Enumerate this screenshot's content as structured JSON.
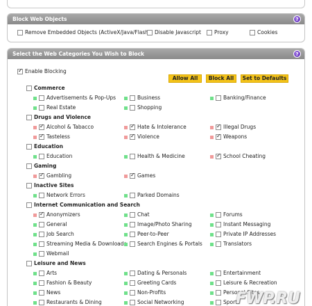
{
  "block_web_objects": {
    "title": "Block Web Objects",
    "help": "?",
    "options": [
      {
        "label": "Remove Embedded Objects (ActiveX/Java/Flash)",
        "checked": false
      },
      {
        "label": "Disable Javascript",
        "checked": false
      },
      {
        "label": "Proxy",
        "checked": false
      },
      {
        "label": "Cookies",
        "checked": false
      }
    ]
  },
  "categories_panel": {
    "title": "Select the Web Categories You Wish to Block",
    "help": "?",
    "enable_blocking": {
      "label": "Enable Blocking",
      "checked": true
    },
    "buttons": {
      "allow_all": "Allow All",
      "block_all": "Block All",
      "defaults": "Set to Defaults"
    },
    "groups": [
      {
        "title": "Commerce",
        "items": [
          {
            "label": "Advertisements & Pop-Ups",
            "checked": false,
            "mark": "green"
          },
          {
            "label": "Business",
            "checked": false,
            "mark": "green"
          },
          {
            "label": "Banking/Finance",
            "checked": false,
            "mark": "green"
          },
          {
            "label": "Real Estate",
            "checked": false,
            "mark": "green"
          },
          {
            "label": "Shopping",
            "checked": false,
            "mark": "green"
          }
        ]
      },
      {
        "title": "Drugs and Violence",
        "items": [
          {
            "label": "Alcohol & Tabacco",
            "checked": true,
            "mark": "red"
          },
          {
            "label": "Hate & Intolerance",
            "checked": true,
            "mark": "red"
          },
          {
            "label": "Illegal Drugs",
            "checked": true,
            "mark": "red"
          },
          {
            "label": "Tasteless",
            "checked": true,
            "mark": "red"
          },
          {
            "label": "Violence",
            "checked": true,
            "mark": "red"
          },
          {
            "label": "Weapons",
            "checked": true,
            "mark": "red"
          }
        ]
      },
      {
        "title": "Education",
        "items": [
          {
            "label": "Education",
            "checked": false,
            "mark": "green"
          },
          {
            "label": "Health & Medicine",
            "checked": false,
            "mark": "green"
          },
          {
            "label": "School Cheating",
            "checked": true,
            "mark": "red"
          }
        ]
      },
      {
        "title": "Gaming",
        "items": [
          {
            "label": "Gambling",
            "checked": true,
            "mark": "red"
          },
          {
            "label": "Games",
            "checked": true,
            "mark": "red"
          }
        ]
      },
      {
        "title": "Inactive Sites",
        "items": [
          {
            "label": "Network Errors",
            "checked": false,
            "mark": "green"
          },
          {
            "label": "Parked Domains",
            "checked": false,
            "mark": "green"
          }
        ]
      },
      {
        "title": "Internet Communication and Search",
        "items": [
          {
            "label": "Anonymizers",
            "checked": true,
            "mark": "red"
          },
          {
            "label": "Chat",
            "checked": false,
            "mark": "green"
          },
          {
            "label": "Forums",
            "checked": false,
            "mark": "green"
          },
          {
            "label": "General",
            "checked": false,
            "mark": "green"
          },
          {
            "label": "Image/Photo Sharing",
            "checked": false,
            "mark": "green"
          },
          {
            "label": "Instant Messaging",
            "checked": false,
            "mark": "green"
          },
          {
            "label": "Job Search",
            "checked": false,
            "mark": "green"
          },
          {
            "label": "Peer-to-Peer",
            "checked": false,
            "mark": "green"
          },
          {
            "label": "Private IP Addresses",
            "checked": false,
            "mark": "green"
          },
          {
            "label": "Streaming Media & Downloads",
            "checked": false,
            "mark": "green"
          },
          {
            "label": "Search Engines & Portals",
            "checked": false,
            "mark": "green"
          },
          {
            "label": "Translators",
            "checked": false,
            "mark": "green"
          },
          {
            "label": "Webmail",
            "checked": false,
            "mark": "green"
          }
        ]
      },
      {
        "title": "Leisure and News",
        "items": [
          {
            "label": "Arts",
            "checked": false,
            "mark": "green"
          },
          {
            "label": "Dating & Personals",
            "checked": false,
            "mark": "green"
          },
          {
            "label": "Entertainment",
            "checked": false,
            "mark": "green"
          },
          {
            "label": "Fashion & Beauty",
            "checked": false,
            "mark": "green"
          },
          {
            "label": "Greeting Cards",
            "checked": false,
            "mark": "green"
          },
          {
            "label": "Leisure & Recreation",
            "checked": false,
            "mark": "green"
          },
          {
            "label": "News",
            "checked": false,
            "mark": "green"
          },
          {
            "label": "Non-Profits",
            "checked": false,
            "mark": "green"
          },
          {
            "label": "Personal Sites",
            "checked": false,
            "mark": "green"
          },
          {
            "label": "Restaurants & Dining",
            "checked": false,
            "mark": "green"
          },
          {
            "label": "Social Networking",
            "checked": false,
            "mark": "green"
          },
          {
            "label": "Sports",
            "checked": false,
            "mark": "green"
          }
        ]
      }
    ]
  },
  "watermark": "FWP.RU",
  "colors": {
    "header": "#999999",
    "button": "#f5c41a",
    "allowed_mark": "#6fe08a",
    "blocked_mark": "#f09a9a",
    "help_icon": "#6a35c8"
  }
}
